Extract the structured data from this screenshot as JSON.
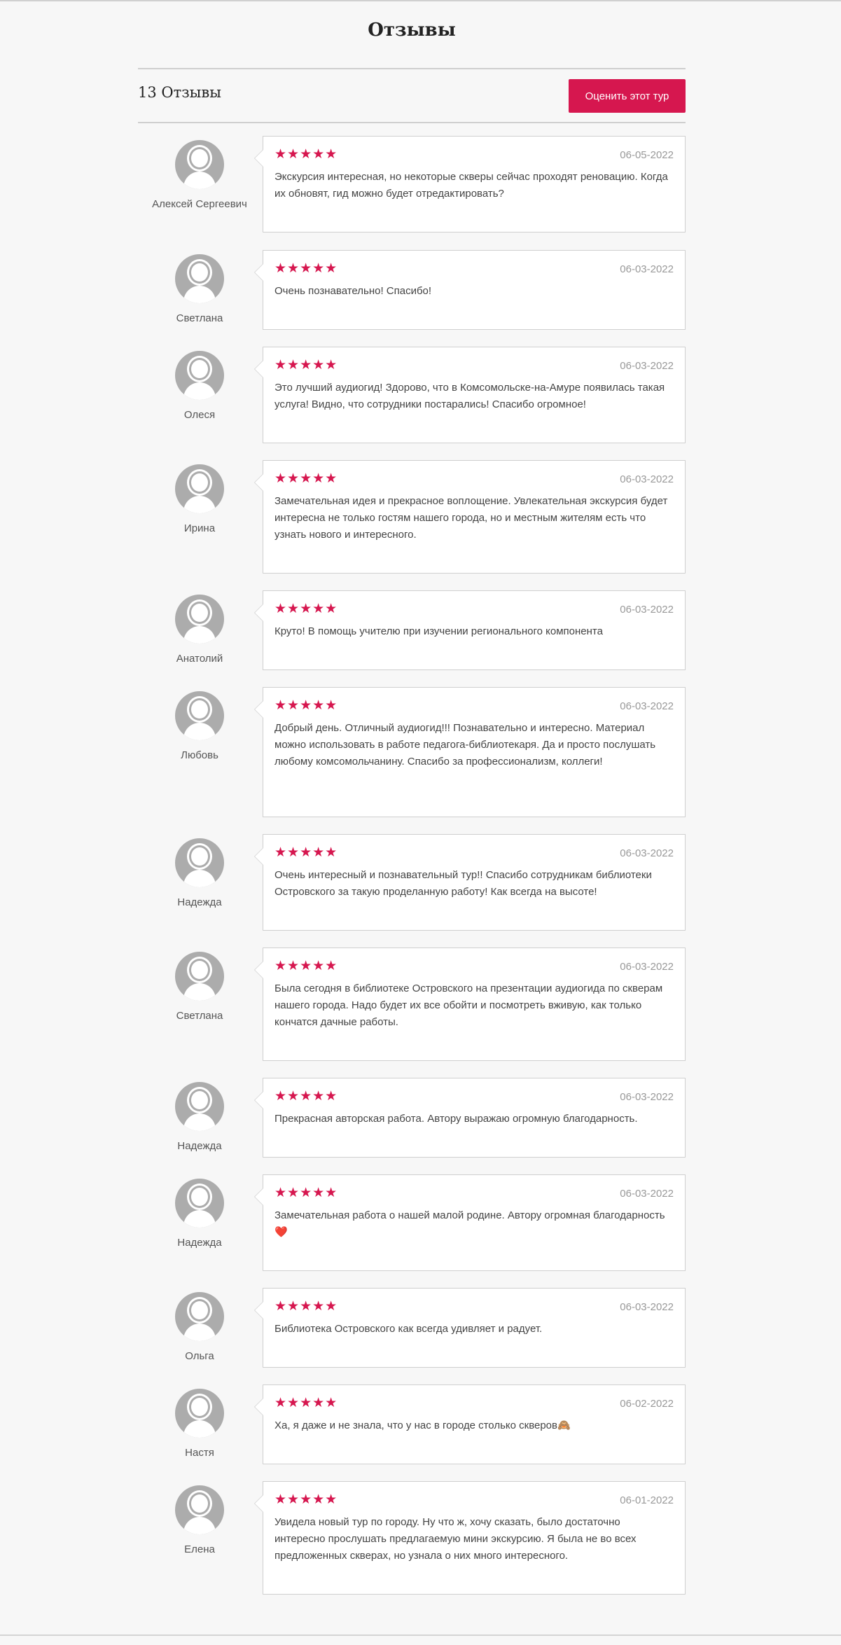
{
  "page": {
    "title": "Отзывы",
    "count_label": "13 Отзывы",
    "rate_button": "Оценить этот тур",
    "accent_color": "#d6174f"
  },
  "reviews": [
    {
      "name": "Алексей Сергеевич",
      "stars": "★★★★★",
      "date": "06-05-2022",
      "text": "Экскурсия интересная, но некоторые скверы сейчас проходят реновацию. Когда их обновят, гид можно будет отредактировать?"
    },
    {
      "name": "Светлана",
      "stars": "★★★★★",
      "date": "06-03-2022",
      "text": "Очень познавательно! Спасибо!"
    },
    {
      "name": "Олеся",
      "stars": "★★★★★",
      "date": "06-03-2022",
      "text": "Это лучший аудиогид! Здорово, что в Комсомольске-на-Амуре появилась такая услуга! Видно, что сотрудники постарались! Спасибо огромное!"
    },
    {
      "name": "Ирина",
      "stars": "★★★★★",
      "date": "06-03-2022",
      "text": "Замечательная идея и прекрасное воплощение. Увлекательная экскурсия будет интересна не только гостям нашего города, но и местным жителям есть что узнать нового и интересного."
    },
    {
      "name": "Анатолий",
      "stars": "★★★★★",
      "date": "06-03-2022",
      "text": "Круто! В помощь учителю при изучении регионального компонента"
    },
    {
      "name": "Любовь",
      "stars": "★★★★★",
      "date": "06-03-2022",
      "text": "Добрый день. Отличный аудиогид!!! Познавательно и интересно. Материал можно использовать в работе педагога-библиотекаря. Да и просто послушать любому комсомольчанину. Спасибо за профессионализм, коллеги!"
    },
    {
      "name": "Надежда",
      "stars": "★★★★★",
      "date": "06-03-2022",
      "text": "Очень интересный и познавательный тур!! Спасибо сотрудникам библиотеки Островского за такую проделанную работу! Как всегда на высоте!"
    },
    {
      "name": "Светлана",
      "stars": "★★★★★",
      "date": "06-03-2022",
      "text": "Была сегодня в библиотеке Островского на презентации аудиогида по скверам нашего города. Надо будет их все обойти и посмотреть вживую, как только кончатся дачные работы."
    },
    {
      "name": "Надежда",
      "stars": "★★★★★",
      "date": "06-03-2022",
      "text": "Прекрасная авторская работа. Автору выражаю огромную благодарность."
    },
    {
      "name": "Надежда",
      "stars": "★★★★★",
      "date": "06-03-2022",
      "text": "Замечательная работа о нашей малой родине. Автору огромная благодарность❤️"
    },
    {
      "name": "Ольга",
      "stars": "★★★★★",
      "date": "06-03-2022",
      "text": "Библиотека Островского как всегда удивляет и радует."
    },
    {
      "name": "Настя",
      "stars": "★★★★★",
      "date": "06-02-2022",
      "text": "Ха, я даже и не знала, что у нас в городе столько скверов🙈"
    },
    {
      "name": "Елена",
      "stars": "★★★★★",
      "date": "06-01-2022",
      "text": "Увидела новый тур по городу. Ну что ж, хочу сказать, было достаточно интересно прослушать предлагаемую мини экскурсию. Я была не во всех предложенных скверах, но узнала о них много интересного."
    }
  ]
}
